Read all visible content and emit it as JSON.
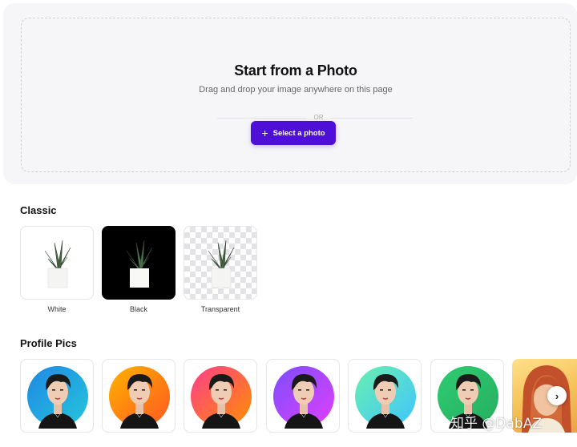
{
  "upload": {
    "title": "Start from a Photo",
    "subtitle": "Drag and drop your image anywhere on this page",
    "or_text": "OR",
    "select_label": "Select a photo",
    "plus_glyph": "+",
    "accent": "#4e0fd6"
  },
  "classic": {
    "title": "Classic",
    "items": [
      {
        "label": "White",
        "background": "#ffffff"
      },
      {
        "label": "Black",
        "background": "#000000"
      },
      {
        "label": "Transparent",
        "background": "checkerboard"
      }
    ]
  },
  "profile": {
    "title": "Profile Pics",
    "gradients": [
      [
        "#1e88e5",
        "#26c6da"
      ],
      [
        "#ffb300",
        "#ff5722"
      ],
      [
        "#ff3d8b",
        "#ff9100"
      ],
      [
        "#7c4dff",
        "#e040fb"
      ],
      [
        "#69f0ae",
        "#40c4ff"
      ],
      [
        "#2ecc71",
        "#27ae60"
      ]
    ],
    "next_glyph": "›"
  },
  "watermark": "知乎 @DabAZ"
}
